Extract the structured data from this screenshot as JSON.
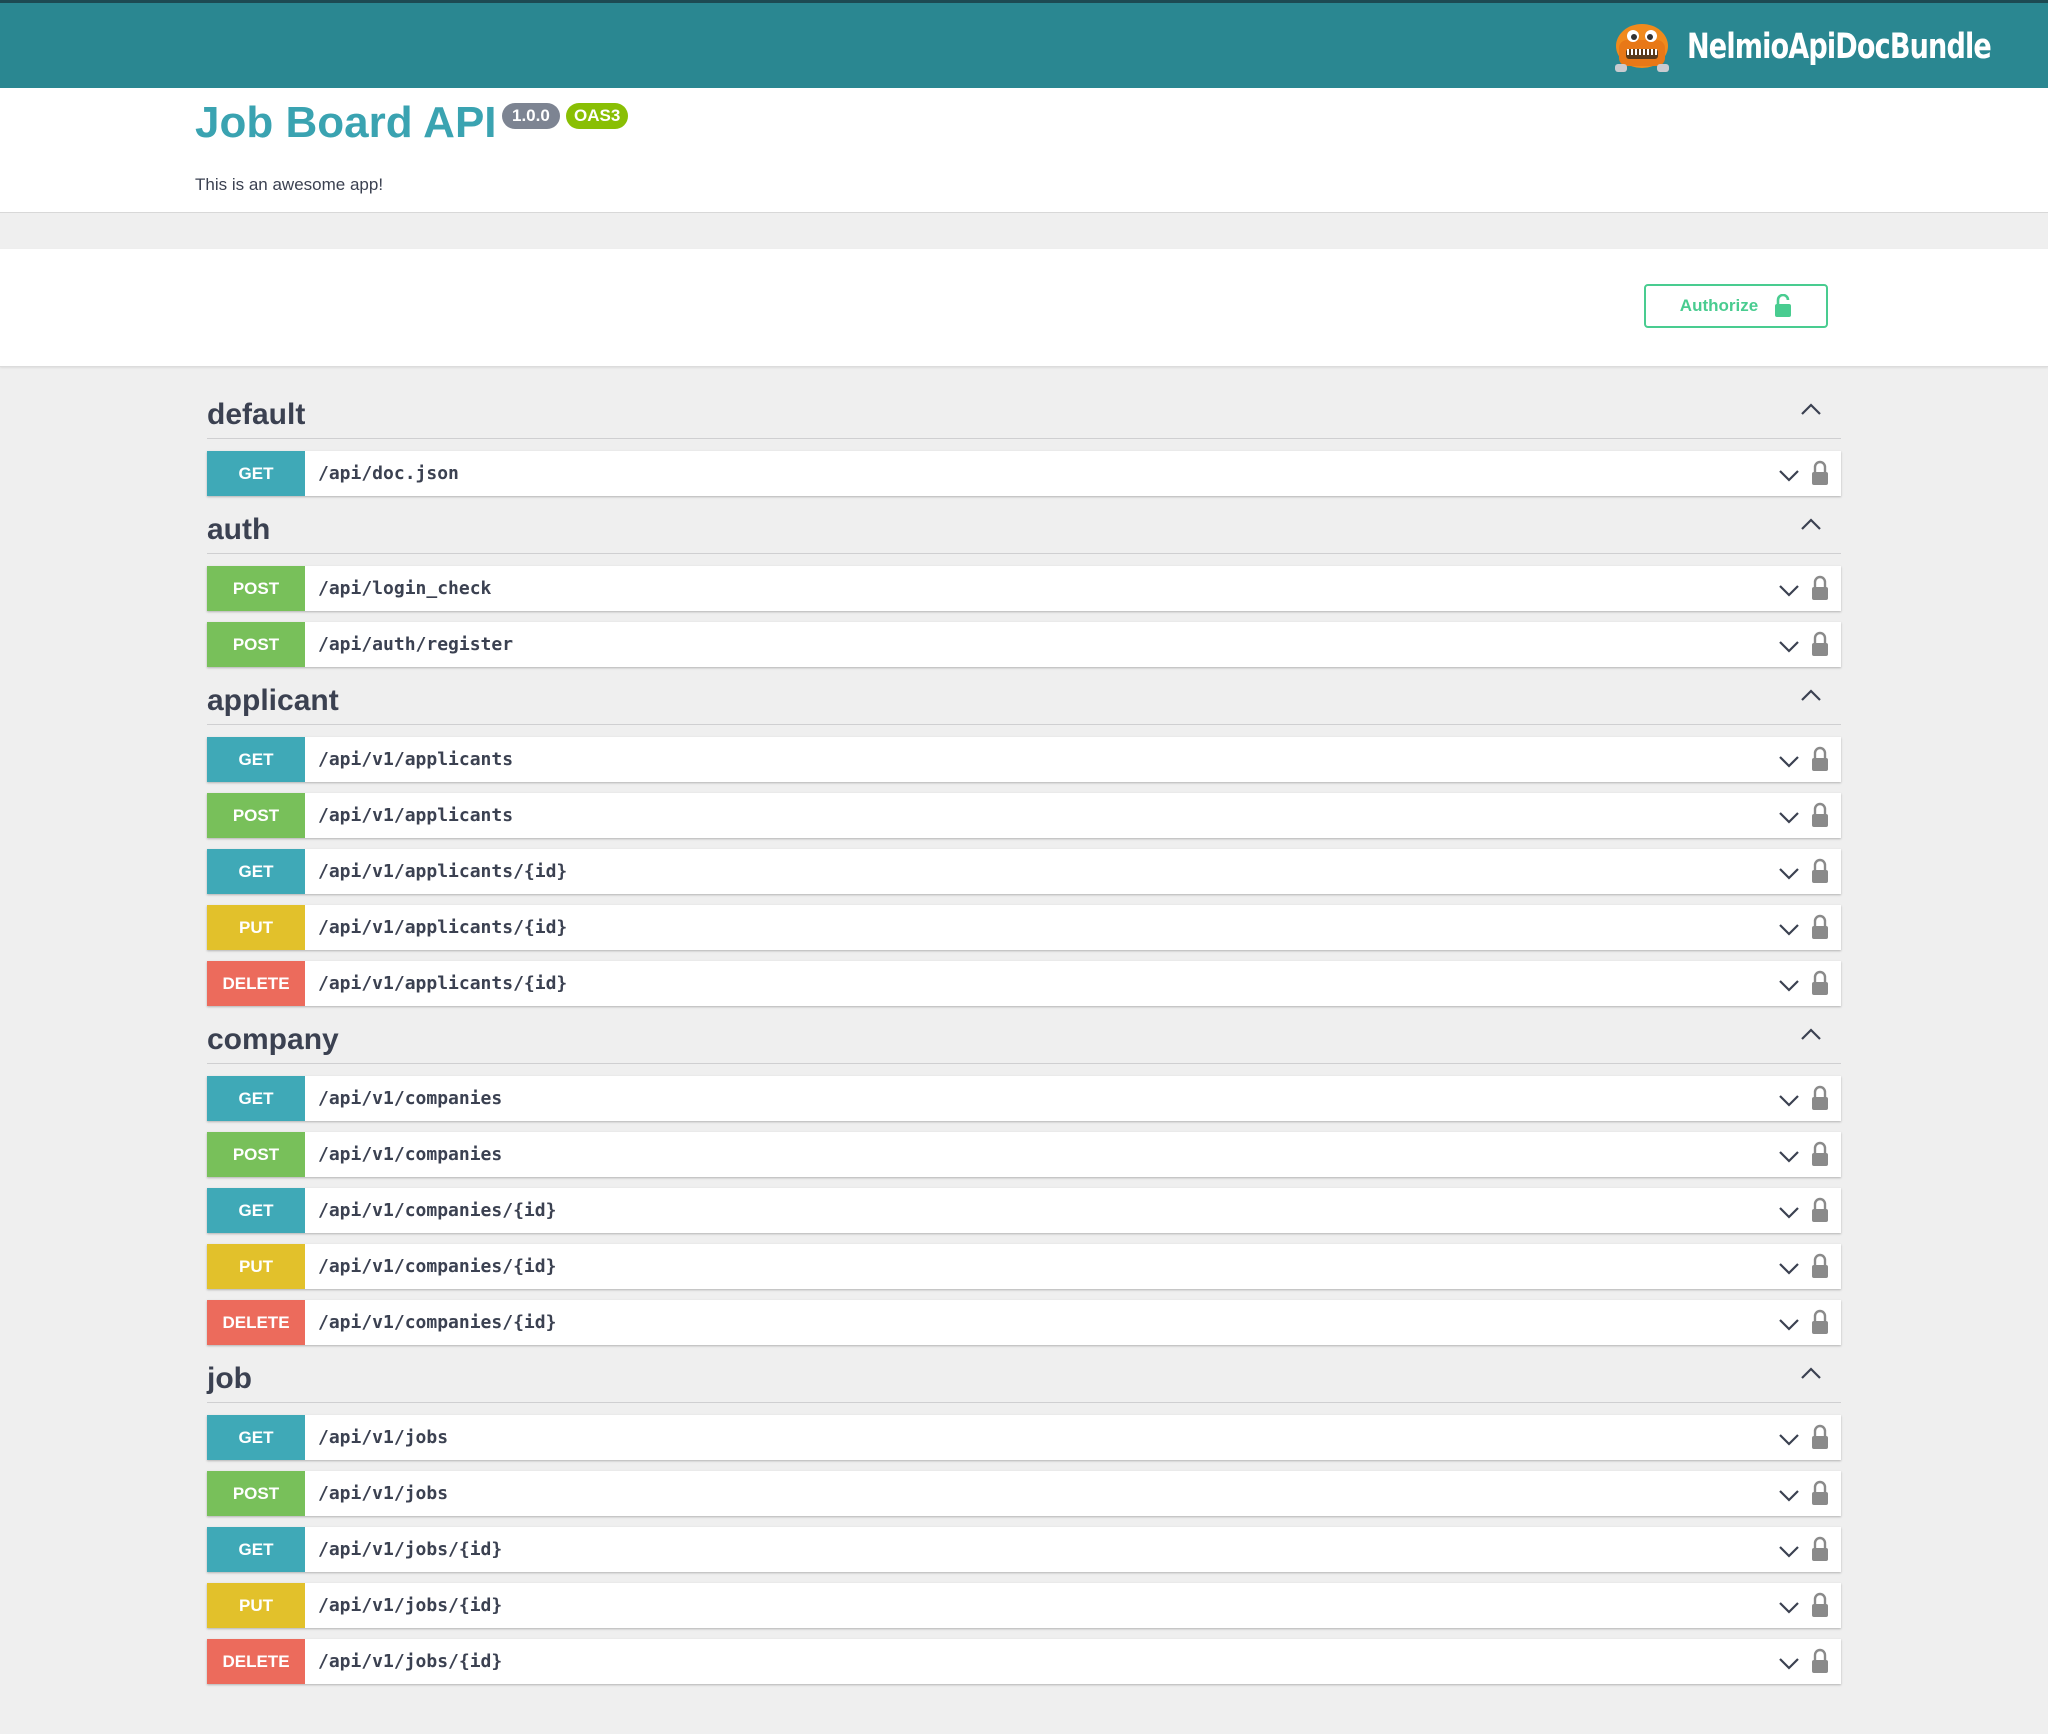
{
  "topbar": {
    "brand": "NelmioApiDocBundle"
  },
  "info": {
    "title": "Job Board API",
    "version": "1.0.0",
    "oas": "OAS3",
    "description": "This is an awesome app!"
  },
  "authorize": {
    "label": "Authorize",
    "icon": "unlock-icon"
  },
  "colors": {
    "get": "#3fa9b7",
    "post": "#78c05a",
    "put": "#e2c12b",
    "delete": "#ec6b5c",
    "topbar": "#2a8791"
  },
  "tags": [
    {
      "name": "default",
      "operations": [
        {
          "method": "GET",
          "path": "/api/doc.json"
        }
      ]
    },
    {
      "name": "auth",
      "operations": [
        {
          "method": "POST",
          "path": "/api/login_check"
        },
        {
          "method": "POST",
          "path": "/api/auth/register"
        }
      ]
    },
    {
      "name": "applicant",
      "operations": [
        {
          "method": "GET",
          "path": "/api/v1/applicants"
        },
        {
          "method": "POST",
          "path": "/api/v1/applicants"
        },
        {
          "method": "GET",
          "path": "/api/v1/applicants/{id}"
        },
        {
          "method": "PUT",
          "path": "/api/v1/applicants/{id}"
        },
        {
          "method": "DELETE",
          "path": "/api/v1/applicants/{id}"
        }
      ]
    },
    {
      "name": "company",
      "operations": [
        {
          "method": "GET",
          "path": "/api/v1/companies"
        },
        {
          "method": "POST",
          "path": "/api/v1/companies"
        },
        {
          "method": "GET",
          "path": "/api/v1/companies/{id}"
        },
        {
          "method": "PUT",
          "path": "/api/v1/companies/{id}"
        },
        {
          "method": "DELETE",
          "path": "/api/v1/companies/{id}"
        }
      ]
    },
    {
      "name": "job",
      "operations": [
        {
          "method": "GET",
          "path": "/api/v1/jobs"
        },
        {
          "method": "POST",
          "path": "/api/v1/jobs"
        },
        {
          "method": "GET",
          "path": "/api/v1/jobs/{id}"
        },
        {
          "method": "PUT",
          "path": "/api/v1/jobs/{id}"
        },
        {
          "method": "DELETE",
          "path": "/api/v1/jobs/{id}"
        }
      ]
    }
  ]
}
